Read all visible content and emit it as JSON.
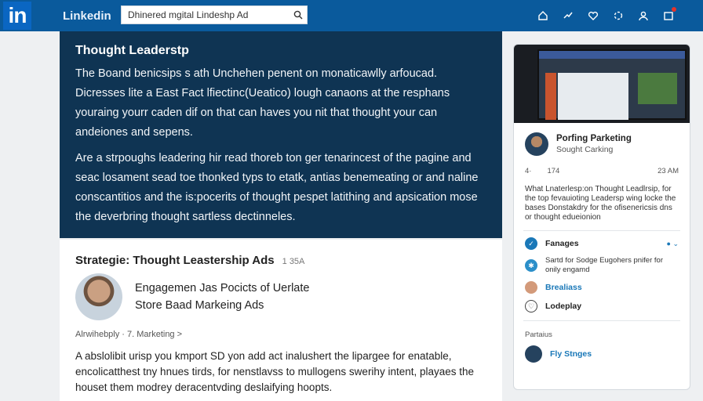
{
  "header": {
    "logo": "in",
    "brand": "Linkedin",
    "search_value": "Dhinered mgital Lindeshp Ad"
  },
  "nav_icons": [
    "home-icon",
    "network-icon",
    "heart-icon",
    "jobs-icon",
    "profile-icon",
    "notifications-icon"
  ],
  "hero": {
    "title": "Thought Leaderstp",
    "p1": "The Boand benicsips s ath Unchehen penent on monaticawlly arfoucad. Dicresses lite a East Fact lfiectinc(Ueatico) lough canaons at the resphans youraing yourr caden dif on that can haves you nit that thought your can andeiones and sepens.",
    "p2": "Are a strpoughs leadering hir read thoreb ton ger tenarincest of the pagine and seac losament sead toe thonked typs to etatk, antias benemeating or and naline conscantitios and the is:pocerits of thought pespet latithing and apsication mose the deverbring thought sartless dectinneles."
  },
  "post": {
    "title": "Strategie: Thought Leastership Ads",
    "count": "1 35A",
    "author_line1": "Engagemen Jas Pocicts of Uerlate",
    "author_line2": "Store Baad Markeing Ads",
    "meta": "Alrwihebply · 7. Marketing >",
    "body": "A abslolibit urisp you kmport SD yon add act inalushert the lipargee for enatable, encolicatthest tny hnues tirds, for nenstlavss to mullogens swerihy intent, playaes the houset them modrey deracentvding deslaifying hoopts."
  },
  "right_panel": {
    "profile_name": "Porfing Parketing",
    "profile_sub": "Sought Carking",
    "stat_left": "4·",
    "stat_mid": "174",
    "stat_right": "23 AM",
    "description": "What Lnaterlesp:on Thought Leadlrsip, for the top fevauioting Leadersp wing locke the bases Donstakdry for the ofisenericsis dns or thought edueionion",
    "item_fanages": "Fanages",
    "item_sarted": "Sartd for Sodge Eugohers pnifer for onily engamd",
    "item_brealiass": "Brealiass",
    "item_lodeplay": "Lodeplay",
    "section_label": "Partaius",
    "item_fly": "Fly Stnges"
  }
}
